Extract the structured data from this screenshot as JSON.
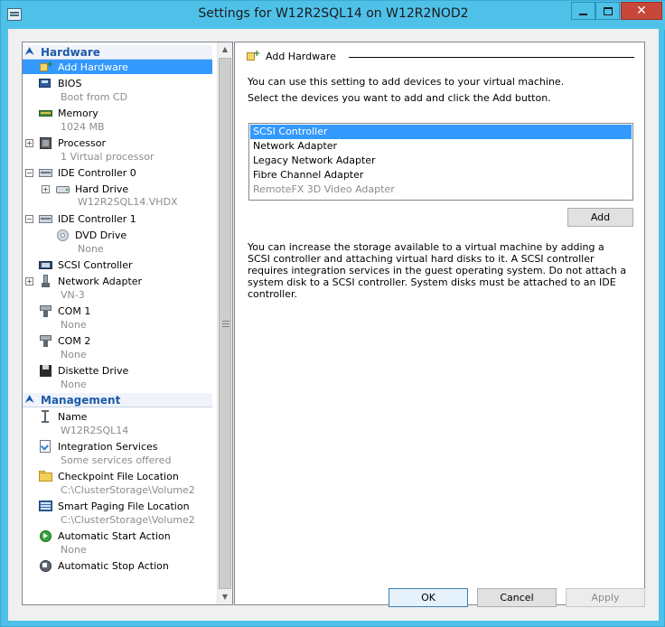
{
  "window": {
    "title": "Settings for W12R2SQL14 on W12R2NOD2",
    "close_glyph": "✕"
  },
  "tree": {
    "hardware_header": "Hardware",
    "management_header": "Management",
    "items": {
      "add_hardware": "Add Hardware",
      "bios": "BIOS",
      "bios_sub": "Boot from CD",
      "memory": "Memory",
      "memory_sub": "1024 MB",
      "processor": "Processor",
      "processor_sub": "1 Virtual processor",
      "ide0": "IDE Controller 0",
      "hard_drive": "Hard Drive",
      "hard_drive_sub": "W12R2SQL14.VHDX",
      "ide1": "IDE Controller 1",
      "dvd_drive": "DVD Drive",
      "dvd_drive_sub": "None",
      "scsi": "SCSI Controller",
      "network_adapter": "Network Adapter",
      "network_adapter_sub": "VN-3",
      "com1": "COM 1",
      "com1_sub": "None",
      "com2": "COM 2",
      "com2_sub": "None",
      "diskette": "Diskette Drive",
      "diskette_sub": "None",
      "name": "Name",
      "name_sub": "W12R2SQL14",
      "integration": "Integration Services",
      "integration_sub": "Some services offered",
      "checkpoint": "Checkpoint File Location",
      "checkpoint_sub": "C:\\ClusterStorage\\Volume2",
      "smart_paging": "Smart Paging File Location",
      "smart_paging_sub": "C:\\ClusterStorage\\Volume2",
      "auto_start": "Automatic Start Action",
      "auto_start_sub": "None",
      "auto_stop": "Automatic Stop Action"
    }
  },
  "panel": {
    "group_title": "Add Hardware",
    "intro": "You can use this setting to add devices to your virtual machine.",
    "instruction": "Select the devices you want to add and click the Add button.",
    "devices": [
      "SCSI Controller",
      "Network Adapter",
      "Legacy Network Adapter",
      "Fibre Channel Adapter",
      "RemoteFX 3D Video Adapter"
    ],
    "add_button": "Add",
    "description": "You can increase the storage available to a virtual machine by adding a SCSI controller and attaching virtual hard disks to it. A SCSI controller requires integration services in the guest operating system. Do not attach a system disk to a SCSI controller. System disks must be attached to an IDE controller."
  },
  "buttons": {
    "ok": "OK",
    "cancel": "Cancel",
    "apply": "Apply"
  },
  "colors": {
    "title_bar": "#4fc1e9",
    "selection": "#3399ff",
    "section_header_text": "#1e5aa8",
    "close_button": "#c7473a"
  }
}
